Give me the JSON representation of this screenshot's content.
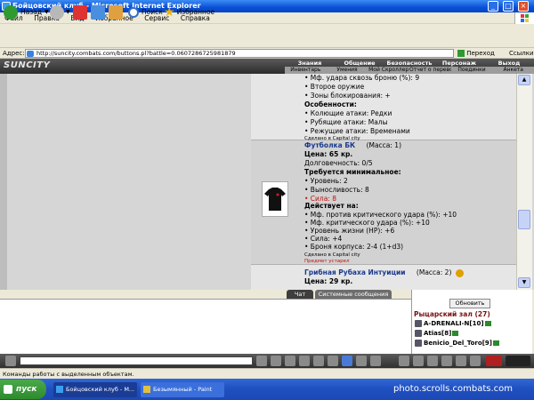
{
  "window": {
    "title": "Бойцовский клуб - Microsoft Internet Explorer",
    "min": "_",
    "max": "□",
    "close": "×"
  },
  "menu": [
    "Файл",
    "Правка",
    "Вид",
    "Избранное",
    "Сервис",
    "Справка"
  ],
  "toolbar": {
    "back": "Назад",
    "search": "Поиск",
    "favorites": "Избранное"
  },
  "address": {
    "label": "Адрес:",
    "url": "http://suncity.combats.com/buttons.pl?battle=0.0607286725981879",
    "go": "Переход",
    "links": "Ссылки"
  },
  "site": {
    "logo": "SUNCITY",
    "nav_top": [
      "Знания",
      "Общение",
      "Безопасность",
      "Персонаж",
      "Выход"
    ],
    "nav_bottom": [
      "Инвентарь",
      "Умения",
      "Мой Скроллер",
      "Отчет о переводах",
      "Поединки",
      "Анкета"
    ]
  },
  "item1_tail": {
    "l1": "• Мф. удара сквозь броню (%): 9",
    "l2": "• Второе оружие",
    "l3": "• Зоны блокирования: +",
    "features": "Особенности:",
    "f1": "• Колющие атаки: Редки",
    "f2": "• Рубящие атаки: Малы",
    "f3": "• Режущие атаки: Временами",
    "made": "Сделано в Capital city"
  },
  "item2": {
    "name": "Футболка БК",
    "mass": "(Масса: 1)",
    "price": "Цена: 65 кр.",
    "durability": "Долговечность: 0/5",
    "req": "Требуется минимальное:",
    "r1": "• Уровень: 2",
    "r2": "• Выносливость: 8",
    "r3": "• Сила: 8",
    "acts": "Действует на:",
    "a1": "• Мф. против критического удара (%): +10",
    "a2": "• Мф. критического удара (%): +10",
    "a3": "• Уровень жизни (HP): +6",
    "a4": "• Сила: +4",
    "a5": "• Броня корпуса: 2-4 (1+d3)",
    "made": "Сделано в Capital city",
    "outdated": "Предмет устарел"
  },
  "item3": {
    "name": "Грибная Рубаха Интуиции",
    "mass": "(Масса: 2)",
    "price": "Цена: 29 кр."
  },
  "tabs": {
    "chat": "Чат",
    "system": "Системные сообщения"
  },
  "room": {
    "refresh": "Обновить",
    "title": "Рыцарский зал (27)",
    "players": [
      "A-DRENALI-N[10]",
      "Atias[8]",
      "Benicio_Del_Toro[9]"
    ]
  },
  "statusbar": {
    "text": "Команды работы с выделенным объектам."
  },
  "taskbar": {
    "start": "пуск",
    "items": [
      "Бойцовский клуб - М...",
      "Безымянный - Paint"
    ],
    "watermark": "photo.scrolls.combats.com"
  }
}
